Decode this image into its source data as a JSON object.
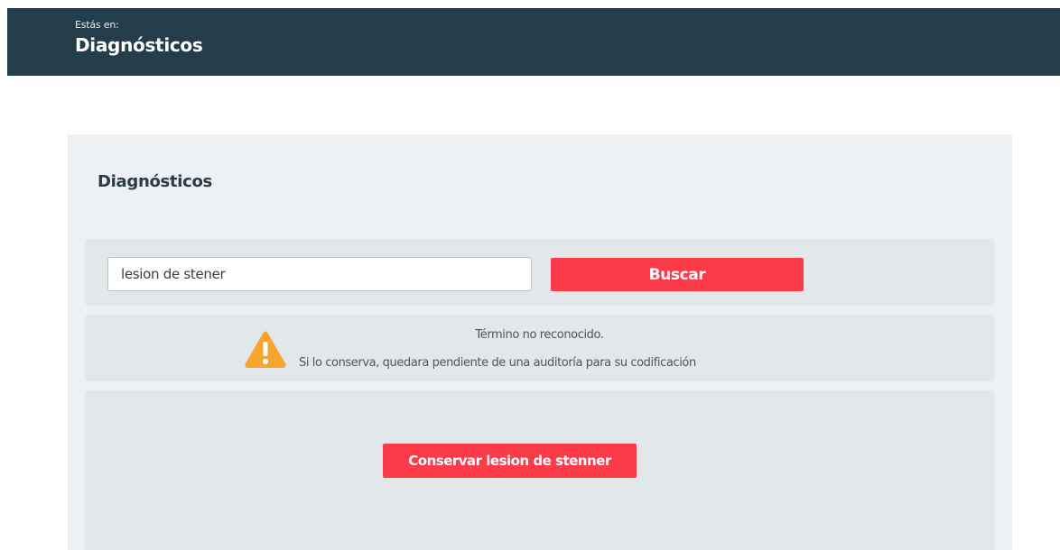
{
  "header": {
    "crumb_label": "Estás en:",
    "crumb_title": "Diagnósticos",
    "background_color": "#233d4a"
  },
  "panel": {
    "title": "Diagnósticos"
  },
  "search": {
    "value": "lesion de stener",
    "button_label": "Buscar",
    "button_color": "#fb3a4a"
  },
  "warning": {
    "icon": "warning-triangle-icon",
    "icon_color": "#f7a531",
    "line1": "Término no reconocido.",
    "line2": "Si lo conserva,  quedara pendiente de una auditoría para su codificación"
  },
  "actions": {
    "keep_button_label": "Conservar lesion de stenner"
  }
}
